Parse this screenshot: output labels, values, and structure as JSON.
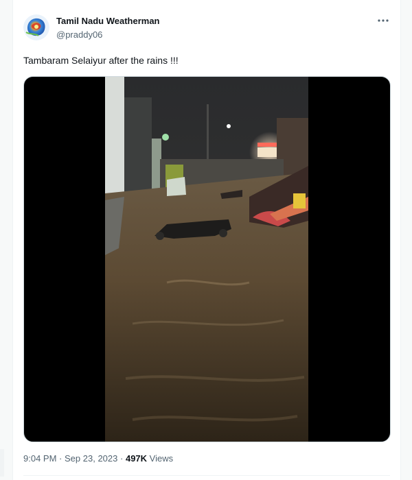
{
  "author": {
    "display_name": "Tamil Nadu Weatherman",
    "handle": "@praddy06",
    "avatar_icon": "weather-radar-avatar"
  },
  "menu": {
    "icon": "more-dots-icon"
  },
  "tweet": {
    "text": "Tambaram Selaiyur after the rains !!!"
  },
  "media": {
    "type": "video",
    "scene_icon": "flooded-street-video-frame"
  },
  "meta": {
    "time": "9:04 PM",
    "separator": "·",
    "date": "Sep 23, 2023",
    "views_count": "497K",
    "views_label": "Views"
  },
  "colors": {
    "primary_text": "#0f1419",
    "secondary_text": "#536471",
    "border": "#eff3f4"
  }
}
